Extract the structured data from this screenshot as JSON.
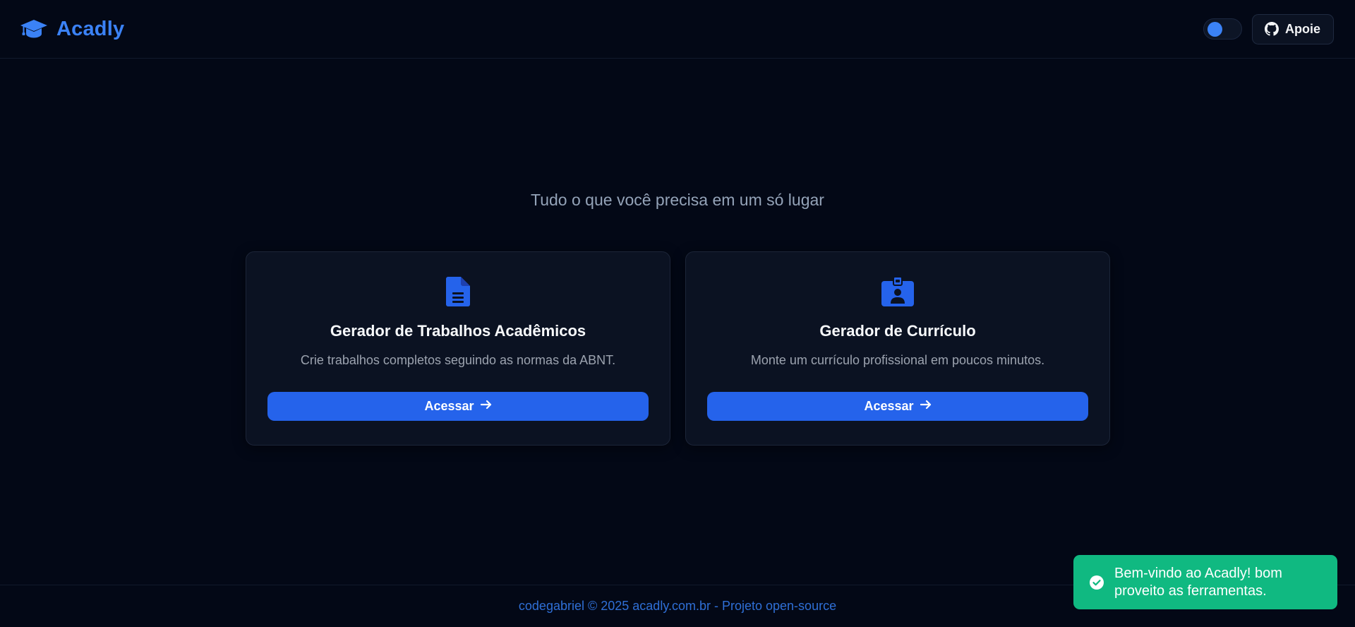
{
  "header": {
    "brand": "Acadly",
    "brand_icon": "graduation-cap-icon",
    "theme_toggle": "theme-toggle",
    "support_label": "Apoie",
    "support_icon": "github-icon"
  },
  "main": {
    "tagline": "Tudo o que você precisa em um só lugar",
    "cards": [
      {
        "icon": "document-icon",
        "title": "Gerador de Trabalhos Acadêmicos",
        "description": "Crie trabalhos completos seguindo as normas da ABNT.",
        "button_label": "Acessar",
        "button_icon": "arrow-right-icon"
      },
      {
        "icon": "id-badge-icon",
        "title": "Gerador de Currículo",
        "description": "Monte um currículo profissional em poucos minutos.",
        "button_label": "Acessar",
        "button_icon": "arrow-right-icon"
      }
    ]
  },
  "footer": {
    "text": "codegabriel © 2025 acadly.com.br - Projeto open-source"
  },
  "toast": {
    "icon": "check-circle-icon",
    "message": "Bem-vindo ao Acadly! bom proveito as ferramentas."
  },
  "colors": {
    "background": "#030816",
    "accent": "#3b82f6",
    "button": "#2563eb",
    "card": "#0b1222",
    "toast": "#10b981"
  }
}
